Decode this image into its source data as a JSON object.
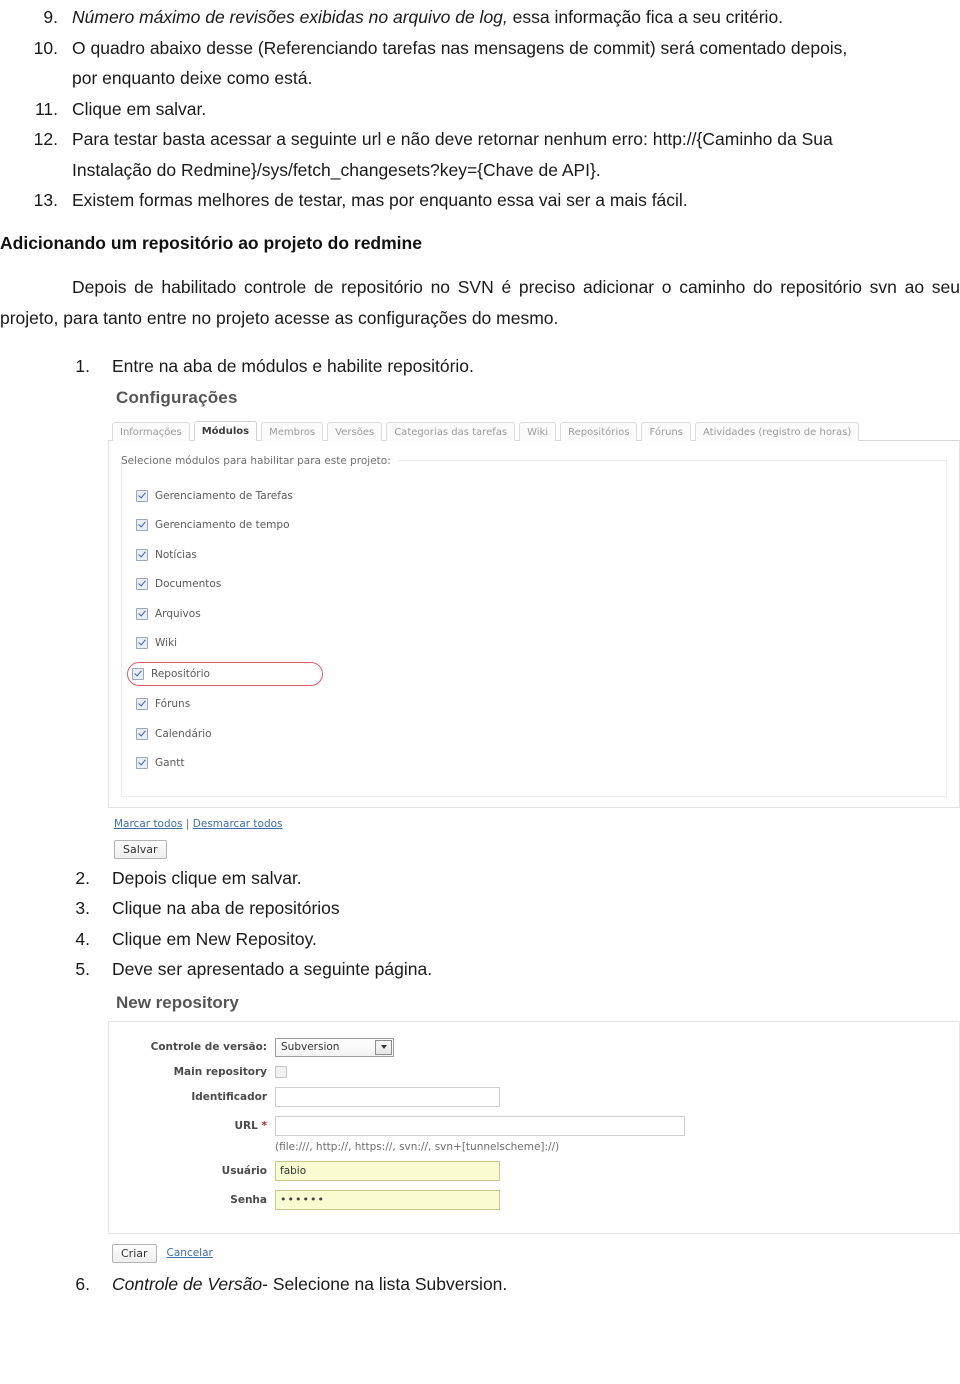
{
  "doc": {
    "list_a": [
      {
        "num": "9.",
        "italic": "Número máximo de revisões exibidas no arquivo de log,",
        "rest": " essa informação fica a seu critério."
      },
      {
        "num": "10.",
        "italic": "",
        "rest": "O quadro abaixo desse (Referenciando tarefas nas mensagens de commit) será comentado depois, por enquanto deixe como está."
      },
      {
        "num": "11.",
        "italic": "",
        "rest": "Clique em salvar."
      },
      {
        "num": "12.",
        "italic": "",
        "rest": "Para testar basta acessar a seguinte url e não deve retornar nenhum erro: http://{Caminho da Sua Instalação do Redmine}/sys/fetch_changesets?key={Chave de API}."
      },
      {
        "num": "13.",
        "italic": "",
        "rest": "Existem formas melhores de testar, mas por enquanto essa vai ser a mais fácil."
      }
    ],
    "section_heading": "Adicionando um repositório ao projeto do redmine",
    "paragraph": "Depois de habilitado controle de repositório no SVN é preciso adicionar o caminho do repositório svn ao seu projeto, para tanto entre no projeto acesse as configurações do mesmo.",
    "list_b": [
      {
        "num": "1.",
        "text": "Entre na aba de módulos e habilite repositório."
      }
    ],
    "list_c": [
      {
        "num": "2.",
        "text": "Depois clique em salvar."
      },
      {
        "num": "3.",
        "text": "Clique na aba de repositórios"
      },
      {
        "num": "4.",
        "text": "Clique em New Repositoy."
      },
      {
        "num": "5.",
        "text": "Deve ser apresentado a seguinte página."
      }
    ],
    "list_d": [
      {
        "num": "6.",
        "italic": "Controle de Versão",
        "rest": "- Selecione na lista Subversion."
      }
    ]
  },
  "settings_screenshot": {
    "title": "Configurações",
    "tabs": [
      {
        "label": "Informações",
        "active": false
      },
      {
        "label": "Módulos",
        "active": true
      },
      {
        "label": "Membros",
        "active": false
      },
      {
        "label": "Versões",
        "active": false
      },
      {
        "label": "Categorias das tarefas",
        "active": false
      },
      {
        "label": "Wiki",
        "active": false
      },
      {
        "label": "Repositórios",
        "active": false
      },
      {
        "label": "Fóruns",
        "active": false
      },
      {
        "label": "Atividades (registro de horas)",
        "active": false
      }
    ],
    "legend": "Selecione módulos para habilitar para este projeto:",
    "modules": [
      {
        "label": "Gerenciamento de Tarefas",
        "checked": true,
        "highlighted": false
      },
      {
        "label": "Gerenciamento de tempo",
        "checked": true,
        "highlighted": false
      },
      {
        "label": "Notícias",
        "checked": true,
        "highlighted": false
      },
      {
        "label": "Documentos",
        "checked": true,
        "highlighted": false
      },
      {
        "label": "Arquivos",
        "checked": true,
        "highlighted": false
      },
      {
        "label": "Wiki",
        "checked": true,
        "highlighted": false
      },
      {
        "label": "Repositório",
        "checked": true,
        "highlighted": true
      },
      {
        "label": "Fóruns",
        "checked": true,
        "highlighted": false
      },
      {
        "label": "Calendário",
        "checked": true,
        "highlighted": false
      },
      {
        "label": "Gantt",
        "checked": true,
        "highlighted": false
      }
    ],
    "check_all": "Marcar todos",
    "separator": "|",
    "uncheck_all": "Desmarcar todos",
    "save_button": "Salvar",
    "highlight_color": "#e05a63"
  },
  "repository_screenshot": {
    "title": "New repository",
    "scm_label": "Controle de versão:",
    "scm_value": "Subversion",
    "main_repo_label": "Main repository",
    "main_repo_checked": false,
    "identifier_label": "Identificador",
    "identifier_value": "",
    "url_label": "URL",
    "url_required": "*",
    "url_value": "",
    "url_hint": "(file:///, http://, https://, svn://, svn+[tunnelscheme]://)",
    "user_label": "Usuário",
    "user_value": "fabio",
    "password_label": "Senha",
    "password_value": "••••••",
    "create_button": "Criar",
    "cancel_link": "Cancelar"
  }
}
